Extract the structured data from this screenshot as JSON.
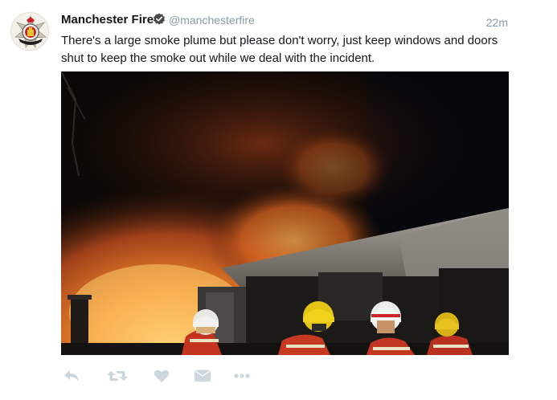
{
  "tweet": {
    "author_name": "Manchester Fire",
    "handle": "@manchesterfire",
    "timestamp": "22m",
    "text": "There's a large smoke plume but please don't worry, just keep windows and doors shut to keep the smoke out while we deal with the incident."
  },
  "icons": {
    "avatar": "fire-service-crest",
    "verified": "verified-badge-icon",
    "reply": "reply-icon",
    "retweet": "retweet-icon",
    "like": "heart-icon",
    "dm": "direct-message-icon",
    "more": "more-dots-icon"
  },
  "colors": {
    "text": "#14171a",
    "muted": "#8899a6",
    "action_icon": "#ccd6dd",
    "verified": "#4a4a4a"
  }
}
